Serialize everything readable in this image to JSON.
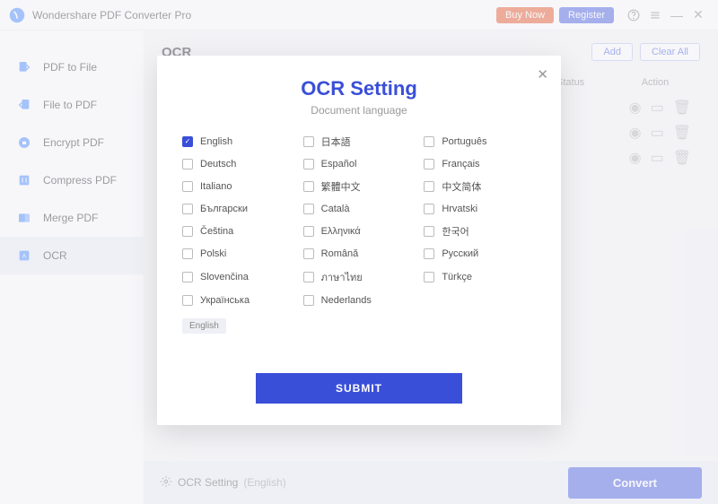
{
  "titlebar": {
    "product": "Wondershare PDF Converter Pro",
    "buy": "Buy Now",
    "register": "Register"
  },
  "sidebar": {
    "items": [
      {
        "label": "PDF to File"
      },
      {
        "label": "File to PDF"
      },
      {
        "label": "Encrypt PDF"
      },
      {
        "label": "Compress PDF"
      },
      {
        "label": "Merge PDF"
      },
      {
        "label": "OCR"
      }
    ]
  },
  "content": {
    "title": "OCR",
    "add": "Add",
    "clear": "Clear All",
    "cols": {
      "status": "Status",
      "action": "Action"
    }
  },
  "bottom": {
    "setting": "OCR Setting",
    "lang": "(English)",
    "convert": "Convert"
  },
  "modal": {
    "title": "OCR Setting",
    "subtitle": "Document language",
    "submit": "SUBMIT",
    "selected": "English",
    "langs": [
      {
        "label": "English",
        "checked": true
      },
      {
        "label": "日本語",
        "checked": false
      },
      {
        "label": "Português",
        "checked": false
      },
      {
        "label": "Deutsch",
        "checked": false
      },
      {
        "label": "Español",
        "checked": false
      },
      {
        "label": "Français",
        "checked": false
      },
      {
        "label": "Italiano",
        "checked": false
      },
      {
        "label": "繁體中文",
        "checked": false
      },
      {
        "label": "中文简体",
        "checked": false
      },
      {
        "label": "Български",
        "checked": false
      },
      {
        "label": "Català",
        "checked": false
      },
      {
        "label": "Hrvatski",
        "checked": false
      },
      {
        "label": "Čeština",
        "checked": false
      },
      {
        "label": "Ελληνικά",
        "checked": false
      },
      {
        "label": "한국어",
        "checked": false
      },
      {
        "label": "Polski",
        "checked": false
      },
      {
        "label": "Română",
        "checked": false
      },
      {
        "label": "Русский",
        "checked": false
      },
      {
        "label": "Slovenčina",
        "checked": false
      },
      {
        "label": "ภาษาไทย",
        "checked": false
      },
      {
        "label": "Türkçe",
        "checked": false
      },
      {
        "label": "Українська",
        "checked": false
      },
      {
        "label": "Nederlands",
        "checked": false
      }
    ]
  }
}
